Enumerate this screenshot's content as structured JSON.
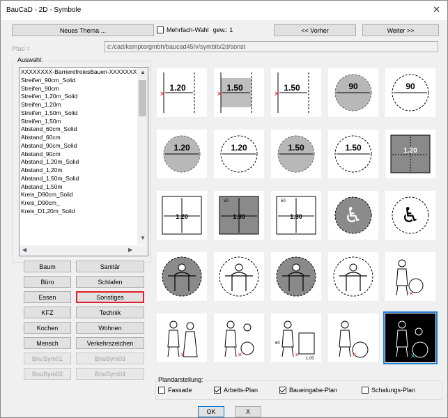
{
  "window": {
    "title": "BauCaD - 2D - Symbole",
    "close": "✕"
  },
  "toolbar": {
    "neues_thema": "Neues Thema ...",
    "mehrfach_wahl": "Mehrfach-Wahl",
    "gew": "gew.: 1",
    "vorher": "<< Vorher",
    "weiter": "Weiter  >>"
  },
  "pfad": {
    "label": "Pfad =",
    "value": "c:/cad/kemptergmbh/baucad45/v/symbib/2d/sonst"
  },
  "auswahl": {
    "label": "Auswahl:",
    "items": [
      "XXXXXXXX-BarrierefreiesBauen-XXXXXXX",
      "Streifen_90cm_Solid",
      "Streifen_90cm",
      "Streifen_1,20m_Solid",
      "Streifen_1,20m",
      "Streifen_1,50m_Solid",
      "Streifen_1,50m",
      "Abstand_60cm_Solid",
      "Abstand_60cm",
      "Abstand_90cm_Solid",
      "Abstand_90cm",
      "Abstand_1,20m_Solid",
      "Abstand_1,20m",
      "Abstand_1,50m_Solid",
      "Abstand_1,50m",
      "Kreis_D90cm_Solid",
      "Kreis_D90cm_",
      "Kreis_D1,20m_Solid"
    ]
  },
  "categories": [
    "Baum",
    "Sanitär",
    "Büro",
    "Schlafen",
    "Essen",
    "Sonstiges",
    "KFZ",
    "Technik",
    "Kochen",
    "Wohnen",
    "Mensch",
    "Verkehrszeichen",
    "BnuSym01",
    "BnuSym03",
    "BnuSym02",
    "BnuSym04"
  ],
  "grid_labels": [
    "1.20",
    "1.50",
    "1.50",
    "90",
    "90",
    "1.20",
    "1.20",
    "1.50",
    "1.50",
    "1.20",
    "1.20",
    "1.80",
    "1.80",
    "50",
    "60",
    "1.00"
  ],
  "plandarstellung": {
    "label": "Plandarstellung:",
    "fassade": "Fassade",
    "arbeits": "Arbeits-Plan",
    "baueingabe": "Baueingabe-Plan",
    "schalungs": "Schalungs-Plan"
  },
  "footer": {
    "ok": "OK",
    "x": "X"
  },
  "colors": {
    "accent": "#e0202a",
    "selection": "#1e7fd6",
    "hatch": "#8a8a8a"
  }
}
